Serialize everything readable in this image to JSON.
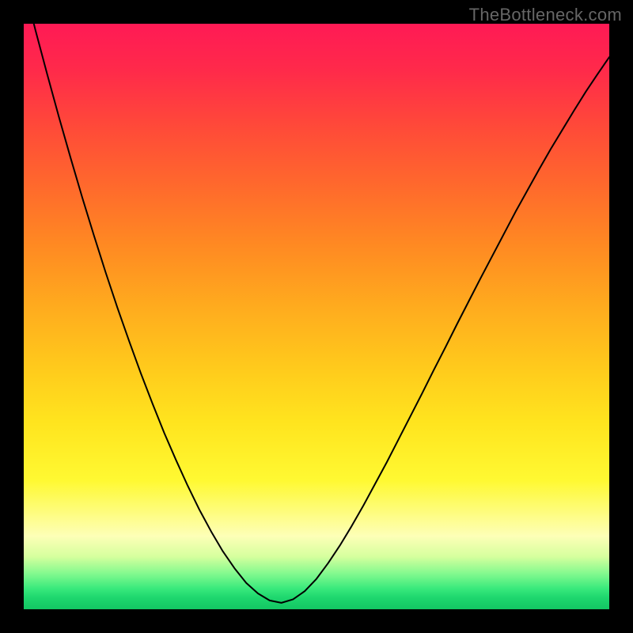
{
  "watermark": "TheBottleneck.com",
  "chart_data": {
    "type": "line",
    "title": "",
    "xlabel": "",
    "ylabel": "",
    "x": [
      0.0,
      0.02,
      0.04,
      0.06,
      0.08,
      0.1,
      0.12,
      0.14,
      0.16,
      0.18,
      0.2,
      0.22,
      0.24,
      0.26,
      0.28,
      0.3,
      0.32,
      0.34,
      0.36,
      0.38,
      0.4,
      0.42,
      0.44,
      0.46,
      0.48,
      0.5,
      0.52,
      0.54,
      0.56,
      0.58,
      0.6,
      0.62,
      0.64,
      0.66,
      0.68,
      0.7,
      0.72,
      0.74,
      0.76,
      0.78,
      0.8,
      0.82,
      0.84,
      0.86,
      0.88,
      0.9,
      0.92,
      0.94,
      0.96,
      0.98,
      1.0
    ],
    "values": [
      1.068,
      0.989,
      0.914,
      0.841,
      0.771,
      0.703,
      0.638,
      0.575,
      0.515,
      0.458,
      0.403,
      0.351,
      0.301,
      0.255,
      0.211,
      0.17,
      0.133,
      0.099,
      0.07,
      0.045,
      0.027,
      0.015,
      0.011,
      0.017,
      0.031,
      0.052,
      0.079,
      0.109,
      0.142,
      0.177,
      0.214,
      0.251,
      0.29,
      0.329,
      0.368,
      0.408,
      0.447,
      0.487,
      0.526,
      0.565,
      0.603,
      0.641,
      0.679,
      0.715,
      0.751,
      0.786,
      0.819,
      0.852,
      0.884,
      0.914,
      0.943
    ],
    "xlim": [
      0,
      1
    ],
    "ylim": [
      0,
      1
    ],
    "highlight_x_range": [
      0.25,
      0.35
    ],
    "highlight_y_max": 0.065,
    "background_gradient": {
      "top": "#ff1a55",
      "bottom": "#13c663"
    }
  }
}
